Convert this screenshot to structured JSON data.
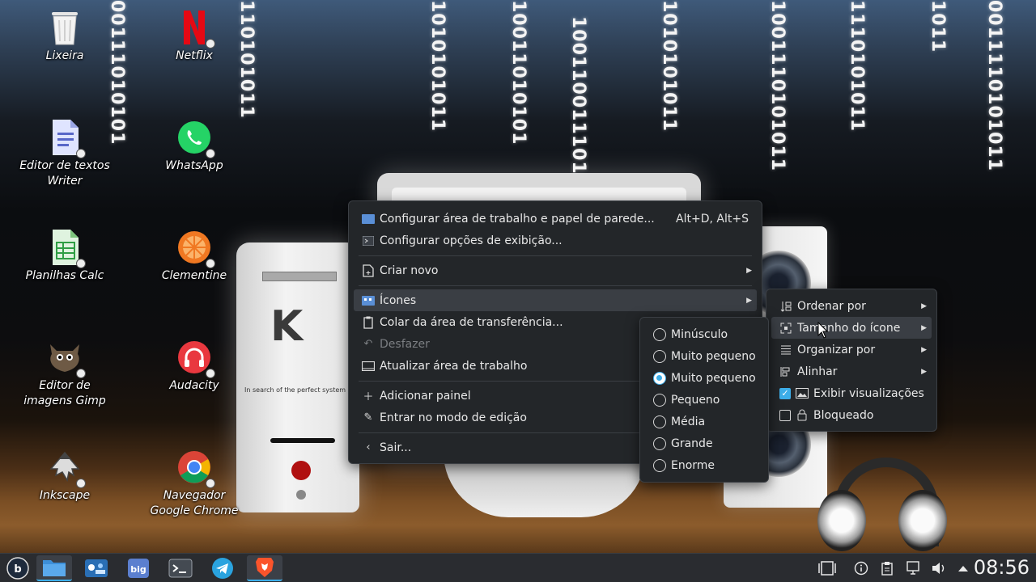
{
  "wallpaper": {
    "binary_strings": [
      "00111010101",
      "110101011",
      "1010101011",
      "10011010101",
      "1001100111010",
      "1010101011",
      "1001110101011",
      "1110101011",
      "1011",
      "0011110101011"
    ],
    "tower_text": "In search of the perfect system",
    "tower_logo": "K"
  },
  "desktop": {
    "icons": [
      {
        "label": "Lixeira",
        "icon": "trash-icon"
      },
      {
        "label": "Netflix",
        "icon": "netflix-icon"
      },
      {
        "label": "Editor de textos Writer",
        "icon": "writer-icon"
      },
      {
        "label": "WhatsApp",
        "icon": "whatsapp-icon"
      },
      {
        "label": "Planilhas Calc",
        "icon": "calc-icon"
      },
      {
        "label": "Clementine",
        "icon": "clementine-icon"
      },
      {
        "label": "Editor de imagens Gimp",
        "icon": "gimp-icon"
      },
      {
        "label": "Audacity",
        "icon": "audacity-icon"
      },
      {
        "label": "Inkscape",
        "icon": "inkscape-icon"
      },
      {
        "label": "Navegador Google Chrome",
        "icon": "chrome-icon"
      }
    ]
  },
  "context_menu": {
    "items": [
      {
        "label": "Configurar área de trabalho e papel de parede...",
        "shortcut": "Alt+D, Alt+S",
        "icon": "desktop-settings-icon"
      },
      {
        "label": "Configurar opções de exibição...",
        "icon": "display-options-icon"
      },
      {
        "label": "Criar novo",
        "icon": "new-file-icon"
      },
      {
        "label": "Ícones",
        "icon": "icons-icon"
      },
      {
        "label": "Colar da área de transferência...",
        "icon": "clipboard-icon"
      },
      {
        "label": "Desfazer",
        "icon": "undo-icon"
      },
      {
        "label": "Atualizar área de trabalho",
        "icon": "refresh-icon"
      },
      {
        "label": "Adicionar painel",
        "icon": "plus-icon"
      },
      {
        "label": "Entrar no modo de edição",
        "icon": "pencil-icon"
      },
      {
        "label": "Sair...",
        "icon": "back-icon"
      }
    ]
  },
  "icons_menu": {
    "items": [
      {
        "label": "Ordenar por",
        "icon": "sort-icon"
      },
      {
        "label": "Tamanho do ícone",
        "icon": "resize-icon"
      },
      {
        "label": "Organizar por",
        "icon": "arrange-icon"
      },
      {
        "label": "Alinhar",
        "icon": "align-icon"
      },
      {
        "label": "Exibir visualizações",
        "icon": "image-icon",
        "checked": true
      },
      {
        "label": "Bloqueado",
        "icon": "lock-icon",
        "checked": false
      }
    ]
  },
  "size_menu": {
    "options": [
      "Minúsculo",
      "Muito pequeno",
      "Muito pequeno",
      "Pequeno",
      "Média",
      "Grande",
      "Enorme"
    ],
    "selected_index": 2
  },
  "taskbar": {
    "apps": [
      "launcher-icon",
      "file-manager-icon",
      "store-icon",
      "biglinux-icon",
      "terminal-icon",
      "telegram-icon",
      "brave-icon"
    ],
    "tray": [
      "activities-icon",
      "info-icon",
      "clipboard-icon",
      "network-icon",
      "volume-icon",
      "expand-tray-icon"
    ],
    "clock": "08:56"
  },
  "colors": {
    "accent": "#3daee9",
    "menu_bg": "#232629",
    "taskbar_bg": "#2a2c30"
  }
}
